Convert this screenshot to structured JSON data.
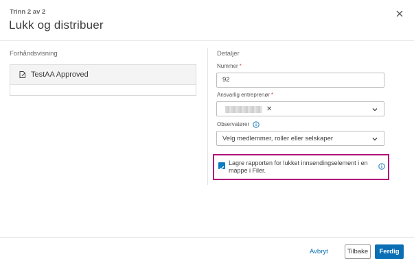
{
  "header": {
    "step": "Trinn 2 av 2",
    "title": "Lukk og distribuer"
  },
  "preview": {
    "section_label": "Forhåndsvisning",
    "item_title": "TestAA Approved",
    "icon": "document-edit-icon"
  },
  "details": {
    "section_label": "Detaljer",
    "number": {
      "label": "Nummer",
      "required_mark": "*",
      "value": "92"
    },
    "contractor": {
      "label": "Ansvarlig entreprenør",
      "required_mark": "*",
      "chip_remove": "✕"
    },
    "observers": {
      "label": "Observatører",
      "placeholder": "Velg medlemmer, roller eller selskaper"
    },
    "save_report": {
      "label": "Lagre rapporten for lukket innsendingselement i en mappe i Filer.",
      "checked": true
    }
  },
  "footer": {
    "cancel_label": "Avbryt",
    "back_label": "Tilbake",
    "finish_label": "Ferdig"
  },
  "colors": {
    "accent": "#0a6fb5",
    "required": "#d6463d",
    "highlight_border": "#b0127a"
  }
}
